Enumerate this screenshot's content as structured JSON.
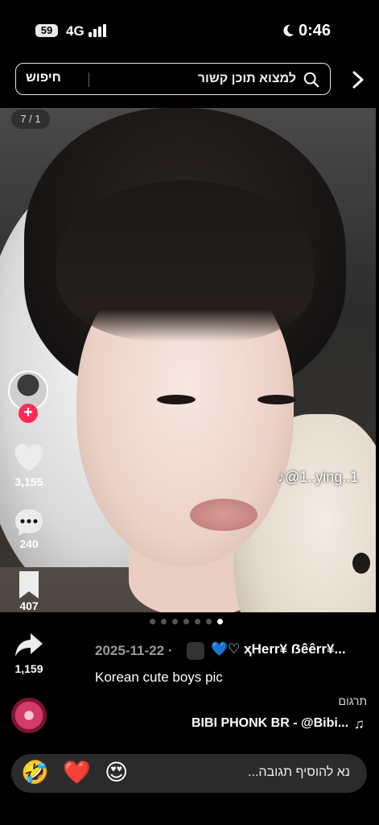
{
  "status": {
    "battery": "59",
    "network": "4G",
    "time": "0:46"
  },
  "search": {
    "button_label": "חיפוש",
    "text": "למצוא תוכן קשור"
  },
  "slide": {
    "counter": "7 / 1",
    "watermark": "♪@1..ying..1",
    "dots_total": 7,
    "dots_active": 7
  },
  "actions": {
    "likes": "3,155",
    "comments": "240",
    "saves": "407",
    "shares": "1,159"
  },
  "post": {
    "date": "2025-11-22 ·",
    "author": "💙♡ ҳHerr¥ ẞêêrr¥...",
    "caption": "Korean cute boys pic",
    "translate": "תרגום",
    "music": "BIBI PHONK BR - @Bibi...",
    "music_icon": "♫"
  },
  "comment": {
    "emojis": [
      "🤣",
      "❤️",
      "😍"
    ],
    "placeholder": "נא להוסיף תגובה..."
  }
}
